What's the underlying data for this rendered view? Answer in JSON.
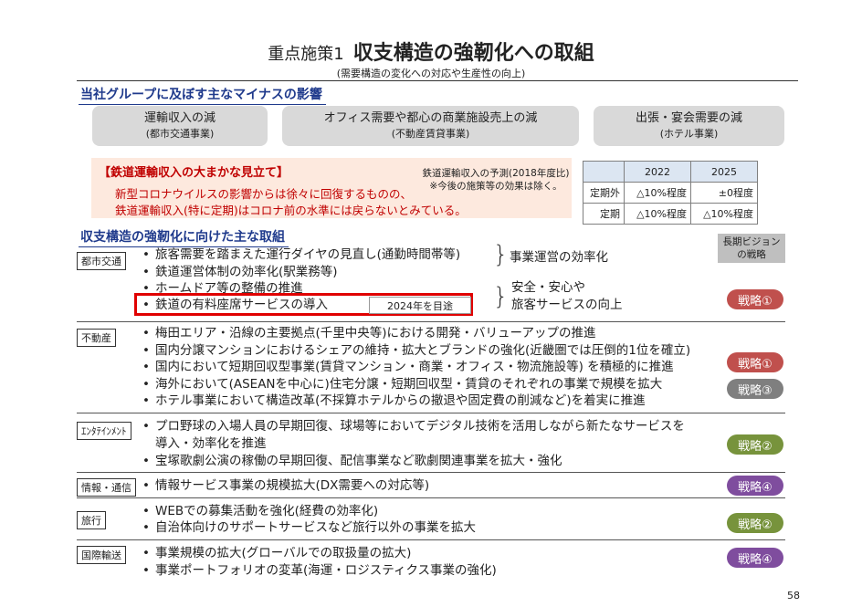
{
  "title": {
    "prefix": "重点施策1",
    "main": "収支構造の強靭化への取組",
    "subtitle": "(需要構造の変化への対応や生産性の向上)"
  },
  "impact": {
    "heading": "当社グループに及ぼす主なマイナスの影響",
    "boxes": [
      {
        "line1": "運輸収入の減",
        "line2": "(都市交通事業)"
      },
      {
        "line1": "オフィス需要や都心の商業施設売上の減",
        "line2": "(不動産賃貸事業)"
      },
      {
        "line1": "出張・宴会需要の減",
        "line2": "(ホテル事業)"
      }
    ]
  },
  "railway_outlook": {
    "title": "【鉄道運輸収入の大まかな見立て】",
    "lines": [
      "新型コロナウイルスの影響からは徐々に回復するものの、",
      "鉄道運輸収入(特に定期)はコロナ前の水準には戻らないとみている。"
    ],
    "forecast_label": "鉄道運輸収入の予測(2018年度比)",
    "forecast_note": "※今後の施策等の効果は除く。",
    "table": {
      "headers": [
        "2022",
        "2025"
      ],
      "rows": [
        {
          "label": "定期外",
          "values": [
            "△10%程度",
            "±0程度"
          ]
        },
        {
          "label": "定期",
          "values": [
            "△10%程度",
            "△10%程度"
          ]
        }
      ]
    }
  },
  "initiatives": {
    "heading": "収支構造の強靭化に向けた主な取組",
    "long_term_header": "長期ビジョンの戦略",
    "long_term_header_lines": [
      "長期ビジョン",
      "の戦略"
    ],
    "bullet": "•",
    "urban": {
      "category": "都市交通",
      "items": [
        "旅客需要を踏まえた運行ダイヤの見直し(通勤時間帯等)",
        "鉄道運営体制の効率化(駅業務等)",
        "ホームドア等の整備の推進",
        "鉄道の有料座席サービスの導入"
      ],
      "group1": "事業運営の効率化",
      "group2_lines": [
        "安全・安心や",
        "旅客サービスの向上"
      ],
      "target_note": "2024年を目途",
      "strategies": [
        "戦略①"
      ]
    },
    "real_estate": {
      "category": "不動産",
      "items": [
        "梅田エリア・沿線の主要拠点(千里中央等)における開発・バリューアップの推進",
        "国内分譲マンションにおけるシェアの維持・拡大とブランドの強化(近畿圏では圧倒的1位を確立)",
        "国内において短期回収型事業(賃貸マンション・商業・オフィス・物流施設等) を積極的に推進",
        "海外において(ASEANを中心に)住宅分譲・短期回収型・賃貸のそれぞれの事業で規模を拡大",
        "ホテル事業において構造改革(不採算ホテルからの撤退や固定費の削減など)を着実に推進"
      ],
      "strategies": [
        "戦略①",
        "戦略③"
      ]
    },
    "entertainment": {
      "category": "ｴﾝﾀﾃｲﾝﾒﾝﾄ",
      "items": [
        "プロ野球の入場人員の早期回復、球場等においてデジタル技術を活用しながら新たなサービスを",
        "導入・効率化を推進",
        "宝塚歌劇公演の稼働の早期回復、配信事業など歌劇関連事業を拡大・強化"
      ],
      "strategies": [
        "戦略②"
      ]
    },
    "info": {
      "category": "情報・通信",
      "items": [
        "情報サービス事業の規模拡大(DX需要への対応等)"
      ],
      "strategies": [
        "戦略④"
      ]
    },
    "travel": {
      "category": "旅行",
      "items": [
        "WEBでの募集活動を強化(経費の効率化)",
        "自治体向けのサポートサービスなど旅行以外の事業を拡大"
      ],
      "strategies": [
        "戦略②"
      ]
    },
    "logistics": {
      "category": "国際輸送",
      "items": [
        "事業規模の拡大(グローバルでの取扱量の拡大)",
        "事業ポートフォリオの変革(海運・ロジスティクス事業の強化)"
      ],
      "strategies": [
        "戦略④"
      ]
    }
  },
  "page_number": "58",
  "colors": {
    "heading_blue": "#1f3a8c",
    "callout_red": "#c00000",
    "strategy1": "#c0504d",
    "strategy2": "#77933c",
    "strategy3": "#7f7f7f",
    "strategy4": "#7f4d9e"
  }
}
